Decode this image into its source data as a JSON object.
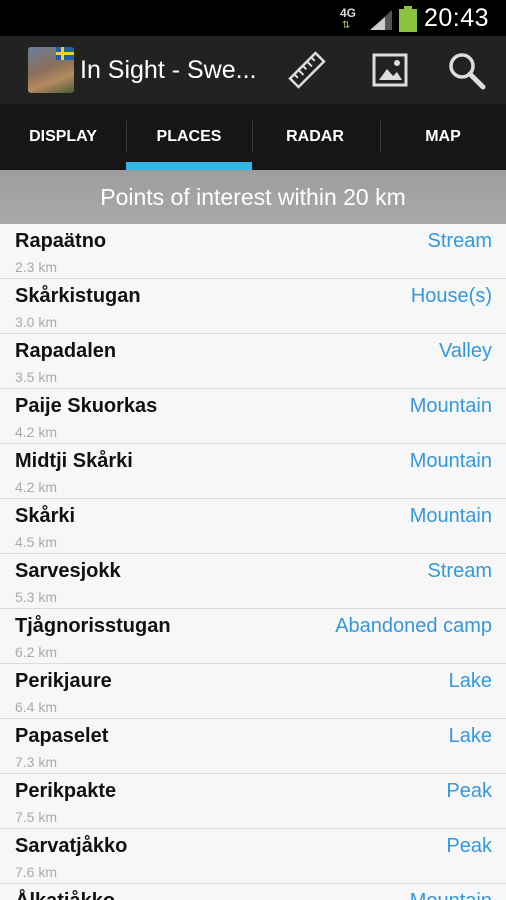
{
  "status_bar": {
    "network": "4G",
    "time": "20:43"
  },
  "action_bar": {
    "title": "In Sight - Swe...",
    "icons": [
      "ruler-icon",
      "image-icon",
      "search-icon"
    ]
  },
  "tabs": [
    {
      "label": "DISPLAY",
      "selected": false
    },
    {
      "label": "PLACES",
      "selected": true
    },
    {
      "label": "RADAR",
      "selected": false
    },
    {
      "label": "MAP",
      "selected": false
    }
  ],
  "header": {
    "text": "Points of interest within 20 km"
  },
  "colors": {
    "accent": "#33b5e5",
    "type_text": "#3498db",
    "header_bg": "#a3a3a3",
    "actionbar_bg": "#222222",
    "tabbar_bg": "#161616"
  },
  "places": [
    {
      "name": "Rapaätno",
      "distance": "2.3 km",
      "type": "Stream"
    },
    {
      "name": "Skårkistugan",
      "distance": "3.0 km",
      "type": "House(s)"
    },
    {
      "name": "Rapadalen",
      "distance": "3.5 km",
      "type": "Valley"
    },
    {
      "name": "Paije Skuorkas",
      "distance": "4.2 km",
      "type": "Mountain"
    },
    {
      "name": "Midtji Skårki",
      "distance": "4.2 km",
      "type": "Mountain"
    },
    {
      "name": "Skårki",
      "distance": "4.5 km",
      "type": "Mountain"
    },
    {
      "name": "Sarvesjokk",
      "distance": "5.3 km",
      "type": "Stream"
    },
    {
      "name": "Tjågnorisstugan",
      "distance": "6.2 km",
      "type": "Abandoned camp"
    },
    {
      "name": "Perikjaure",
      "distance": "6.4 km",
      "type": "Lake"
    },
    {
      "name": "Papaselet",
      "distance": "7.3 km",
      "type": "Lake"
    },
    {
      "name": "Perikpakte",
      "distance": "7.5 km",
      "type": "Peak"
    },
    {
      "name": "Sarvatjåkko",
      "distance": "7.6 km",
      "type": "Peak"
    },
    {
      "name": "Ålkatjåkko",
      "distance": "",
      "type": "Mountain"
    }
  ]
}
